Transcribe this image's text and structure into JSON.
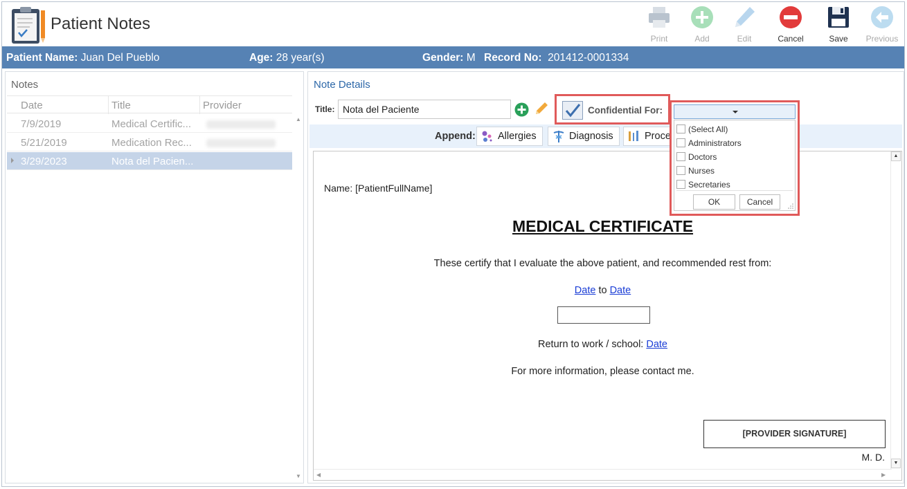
{
  "app": {
    "title": "Patient Notes"
  },
  "toolbar": {
    "print": "Print",
    "add": "Add",
    "edit": "Edit",
    "cancel": "Cancel",
    "save": "Save",
    "previous": "Previous"
  },
  "patient": {
    "name_label": "Patient Name:",
    "name": "Juan Del Pueblo",
    "age_label": "Age:",
    "age": "28 year(s)",
    "gender_label": "Gender:",
    "gender": "M",
    "record_label": "Record No:",
    "record": "201412-0001334"
  },
  "notes": {
    "title": "Notes",
    "columns": {
      "date": "Date",
      "title": "Title",
      "provider": "Provider"
    },
    "rows": [
      {
        "date": "7/9/2019",
        "title": "Medical Certific...",
        "selected": false
      },
      {
        "date": "5/21/2019",
        "title": "Medication Rec...",
        "selected": false
      },
      {
        "date": "3/29/2023",
        "title": "Nota del Pacien...",
        "selected": true
      }
    ]
  },
  "detail": {
    "title": "Note Details",
    "title_label": "Title:",
    "title_value": "Nota del Paciente",
    "confidential_label": "Confidential For:",
    "append_label": "Append:",
    "append_buttons": {
      "allergies": "Allergies",
      "diagnosis": "Diagnosis",
      "procedures": "Proced"
    }
  },
  "document": {
    "name_line": "Name: [PatientFullName]",
    "heading": "MEDICAL CERTIFICATE",
    "certify": "These certify that I evaluate the above patient, and recommended rest from:",
    "date_link": "Date",
    "to": "to",
    "return_text": "Return to work / school:",
    "contact": "For more information, please contact me.",
    "signature": "[PROVIDER SIGNATURE]",
    "md": "M. D."
  },
  "dropdown": {
    "items": [
      "(Select All)",
      "Administrators",
      "Doctors",
      "Nurses",
      "Secretaries"
    ],
    "ok": "OK",
    "cancel": "Cancel"
  },
  "colors": {
    "patient_bar": "#5682b4",
    "highlight": "#e05a5a",
    "selected_row": "#c5d4e8",
    "accent_blue": "#2c67a8"
  }
}
